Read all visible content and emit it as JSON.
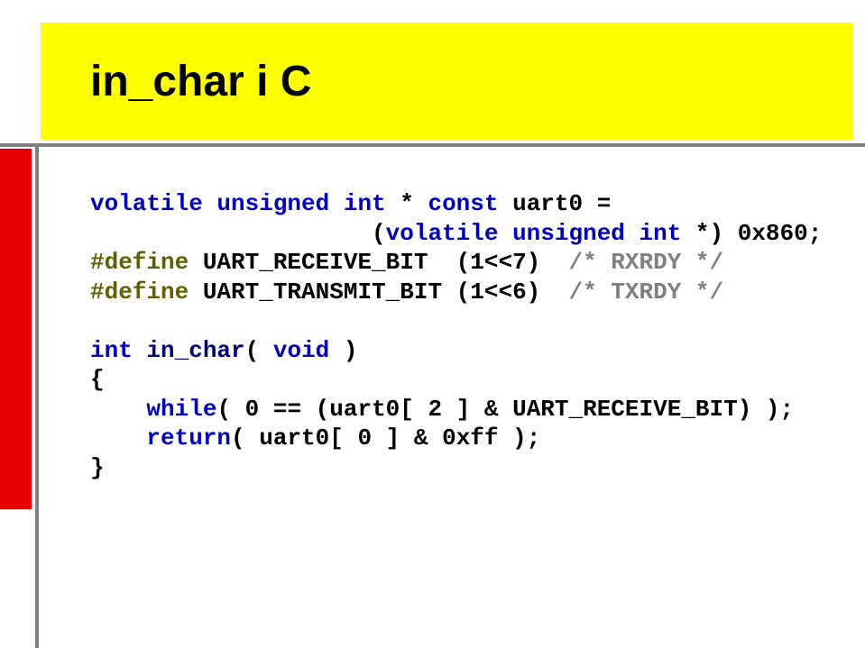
{
  "title": "in_char i C",
  "code": {
    "l1": {
      "kw1": "volatile unsigned int",
      "txt1": " * ",
      "kw2": "const",
      "txt2": " uart0 ="
    },
    "l2": {
      "pad": "                    (",
      "kw1": "volatile unsigned int",
      "txt1": " *) 0x860;"
    },
    "l3": {
      "pp": "#define",
      "txt1": " UART_RECEIVE_BIT  (1<<7)  ",
      "cm": "/* RXRDY */"
    },
    "l4": {
      "pp": "#define",
      "txt1": " UART_TRANSMIT_BIT (1<<6)  ",
      "cm": "/* TXRDY */"
    },
    "l5": "",
    "l6": {
      "kw1": "int",
      "txt1": " ",
      "fn": "in_char",
      "txt2": "( ",
      "kw2": "void",
      "txt3": " )"
    },
    "l7": "{",
    "l8": {
      "txt1": "    ",
      "kw1": "while",
      "txt2": "( 0 == (uart0[ 2 ] & UART_RECEIVE_BIT) );"
    },
    "l9": {
      "txt1": "    ",
      "kw1": "return",
      "txt2": "( uart0[ 0 ] & 0xff );"
    },
    "l10": "}"
  }
}
